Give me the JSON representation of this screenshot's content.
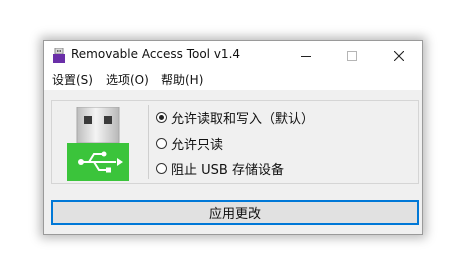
{
  "window": {
    "title": "Removable Access Tool v1.4",
    "icon": "usb-drive-icon",
    "controls": [
      "minimize-icon",
      "maximize-icon",
      "close-icon"
    ]
  },
  "menu": {
    "items": [
      {
        "label": "设置(S)"
      },
      {
        "label": "选项(O)"
      },
      {
        "label": "帮助(H)"
      }
    ]
  },
  "options": {
    "selected_index": 0,
    "items": [
      {
        "label": "允许读取和写入（默认）",
        "checked": true
      },
      {
        "label": "允许只读",
        "checked": false
      },
      {
        "label": "阻止 USB 存储设备",
        "checked": false
      }
    ]
  },
  "graphic": {
    "icon": "usb-drive-icon",
    "accent_color": "#3bc43b"
  },
  "apply_button": {
    "label": "应用更改"
  },
  "colors": {
    "focus_border": "#0078d7",
    "window_bg": "#f0f0f0",
    "usb_green": "#3bc43b"
  }
}
